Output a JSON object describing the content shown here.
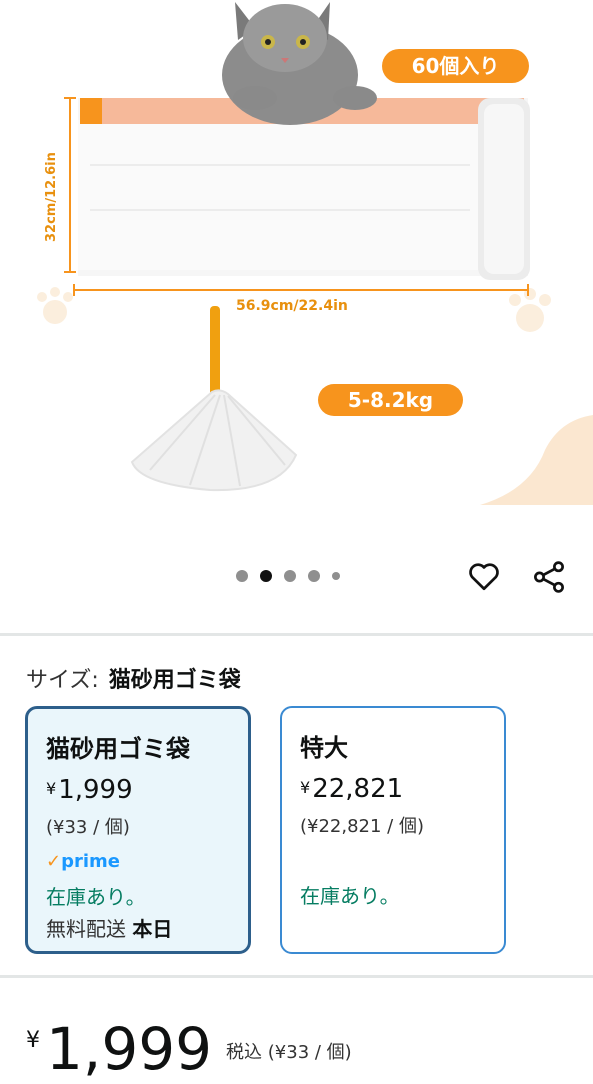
{
  "hero": {
    "count_badge": "60個入り",
    "height_dim": "32cm/12.6in",
    "width_dim": "56.9cm/22.4in",
    "weight_badge": "5-8.2kg",
    "accent_color": "#f7941d",
    "image_count": 5,
    "active_image_index": 1
  },
  "actions": {
    "favorite_icon": "heart-outline-icon",
    "share_icon": "share-icon"
  },
  "size": {
    "label": "サイズ:",
    "selected": "猫砂用ゴミ袋"
  },
  "options": [
    {
      "name": "猫砂用ゴミ袋",
      "currency": "¥",
      "price": "1,999",
      "unit_price": "(¥33 / 個)",
      "prime": "prime",
      "stock": "在庫あり。",
      "shipping_prefix": "無料配送",
      "shipping_day": "本日"
    },
    {
      "name": "特大",
      "currency": "¥",
      "price": "22,821",
      "unit_price": "(¥22,821 / 個)",
      "stock": "在庫あり。"
    }
  ],
  "price_summary": {
    "currency": "¥",
    "price": "1,999",
    "tax_note": "税込 (¥33 / 個)"
  }
}
